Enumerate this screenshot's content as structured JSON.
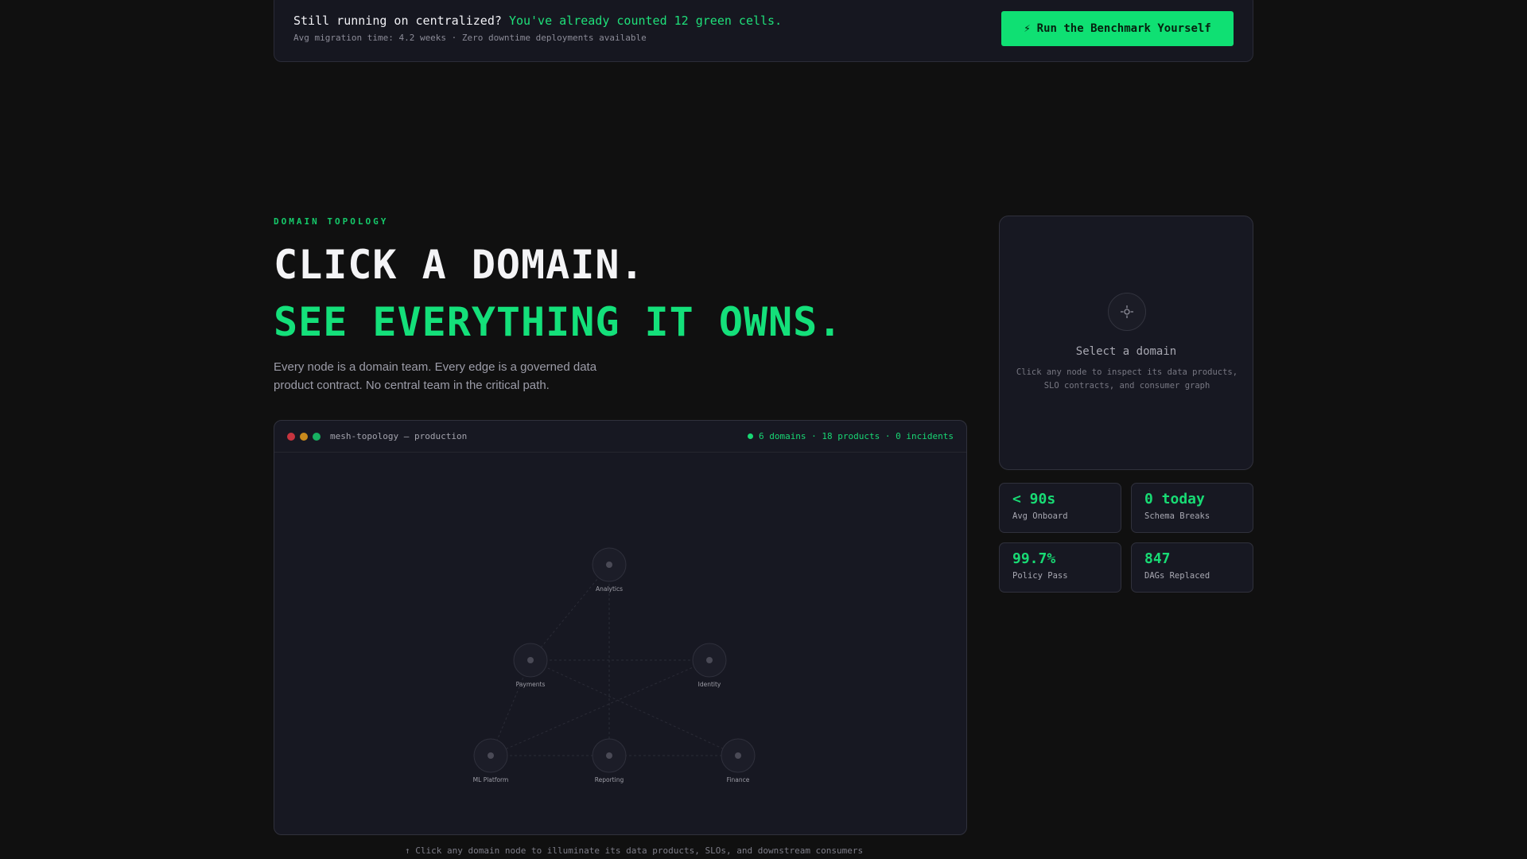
{
  "cta": {
    "title_prefix": "Still running on centralized?",
    "title_accent": "You've already counted 12 green cells.",
    "subtitle": "Avg migration time: 4.2 weeks · Zero downtime deployments available",
    "button_icon": "⚡",
    "button_label": "Run the Benchmark Yourself"
  },
  "hero": {
    "eyebrow": "DOMAIN TOPOLOGY",
    "headline_1": "CLICK A DOMAIN.",
    "headline_2": "SEE EVERYTHING IT OWNS.",
    "description": "Every node is a domain team. Every edge is a governed data product contract. No central team in the critical path."
  },
  "topology": {
    "window_title": "mesh-topology — production",
    "status": "6 domains · 18 products · 0 incidents",
    "nodes": [
      {
        "id": "analytics",
        "label": "Analytics"
      },
      {
        "id": "payments",
        "label": "Payments"
      },
      {
        "id": "identity",
        "label": "Identity"
      },
      {
        "id": "ml",
        "label": "ML Platform"
      },
      {
        "id": "reporting",
        "label": "Reporting"
      },
      {
        "id": "finance",
        "label": "Finance"
      }
    ],
    "hint": "↑ Click any domain node to illuminate its data products, SLOs, and downstream consumers"
  },
  "inspector": {
    "icon": "crosshair-icon",
    "title": "Select a domain",
    "description": "Click any node to inspect its data products, SLO contracts, and consumer graph"
  },
  "stats": [
    {
      "value": "< 90s",
      "label": "Avg Onboard"
    },
    {
      "value": "0 today",
      "label": "Schema Breaks"
    },
    {
      "value": "99.7%",
      "label": "Policy Pass"
    },
    {
      "value": "847",
      "label": "DAGs Replaced"
    }
  ],
  "colors": {
    "accent": "#14e07a",
    "background": "#101010",
    "panel": "#171822"
  }
}
